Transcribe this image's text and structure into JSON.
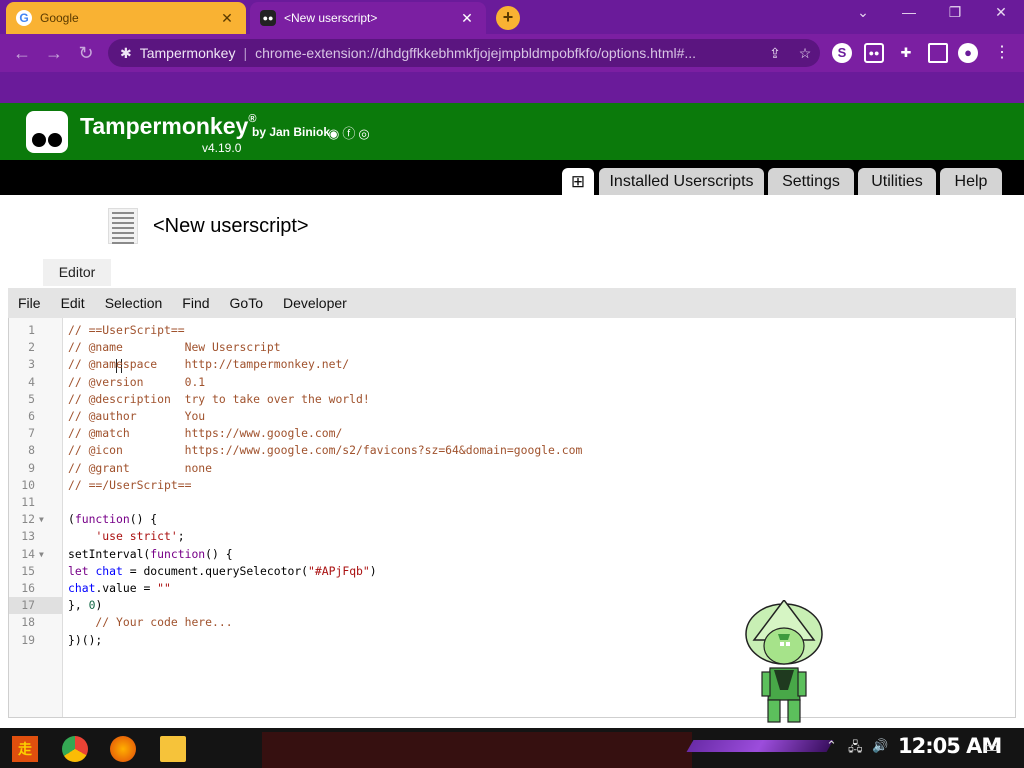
{
  "browser": {
    "tabs": [
      {
        "title": "Google",
        "favicon": "google-icon",
        "active": false
      },
      {
        "title": "<New userscript>",
        "favicon": "tampermonkey-icon",
        "active": true
      }
    ],
    "omnibox": {
      "site": "Tampermonkey",
      "url": "chrome-extension://dhdgffkkebhmkfjojejmpbldmpobfkfo/options.html#..."
    },
    "colors": {
      "frame": "#6a1b9a",
      "inactive_tab": "#f9b233"
    }
  },
  "tm": {
    "brand": "Tampermonkey",
    "registered": "®",
    "by": "by Jan Biniok",
    "version": "v4.19.0",
    "nav": [
      "Installed Userscripts",
      "Settings",
      "Utilities",
      "Help"
    ],
    "colors": {
      "header": "#0b7a0b",
      "nav": "#000000"
    }
  },
  "script": {
    "title": "<New userscript>",
    "editor_tab": "Editor"
  },
  "menu": [
    "File",
    "Edit",
    "Selection",
    "Find",
    "GoTo",
    "Developer"
  ],
  "editor": {
    "active_line": 17,
    "lines": [
      "// ==UserScript==",
      "// @name         New Userscript",
      "// @namespace    http://tampermonkey.net/",
      "// @version      0.1",
      "// @description  try to take over the world!",
      "// @author       You",
      "// @match        https://www.google.com/",
      "// @icon         https://www.google.com/s2/favicons?sz=64&domain=google.com",
      "// @grant        none",
      "// ==/UserScript==",
      "",
      "(function() {",
      "    'use strict';",
      "setInterval(function() {",
      "let chat = document.querySelecotor(\"#APjFqb\")",
      "chat.value = \"\"",
      "}, 0)",
      "    // Your code here...",
      "})();"
    ],
    "fold_lines": [
      12,
      14
    ]
  },
  "taskbar": {
    "clock": "12:05 AM"
  }
}
